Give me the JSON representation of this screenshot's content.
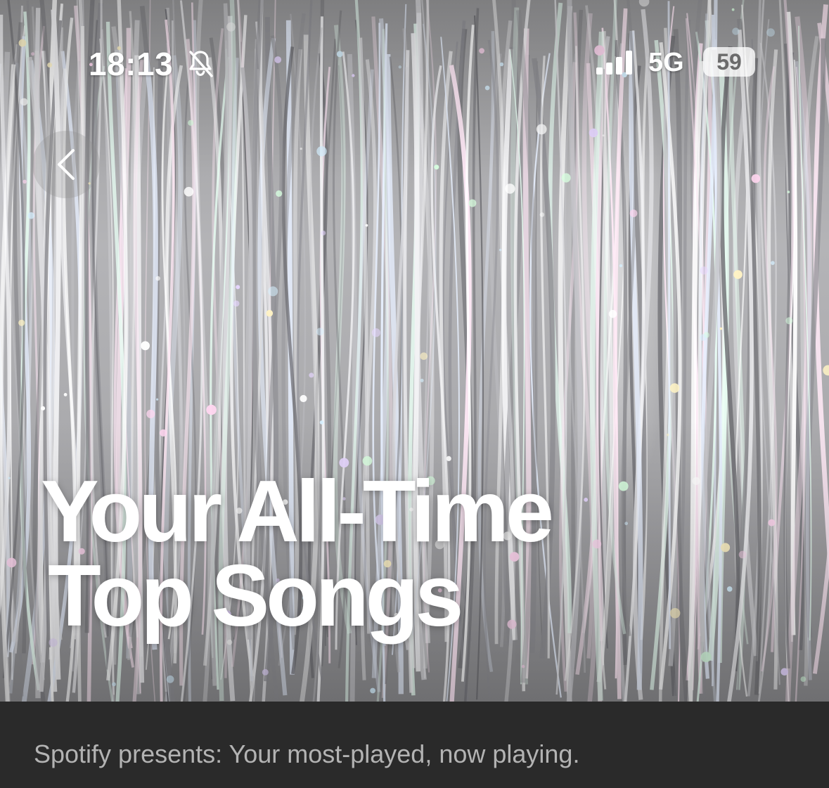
{
  "status_bar": {
    "time": "18:13",
    "network": "5G",
    "battery": "59",
    "icons": [
      "bell-slash-icon",
      "cellular-signal-icon"
    ]
  },
  "navigation": {
    "back_icon": "chevron-left-icon"
  },
  "hero": {
    "title_line_1": "Your All-Time",
    "title_line_2": "Top Songs",
    "background": "silver-tinsel-image"
  },
  "description": "Spotify presents: Your most-played, now playing.",
  "colors": {
    "band_background": "#2a2a2a",
    "description_text": "#b3b3b3",
    "title_text": "#ffffff"
  }
}
